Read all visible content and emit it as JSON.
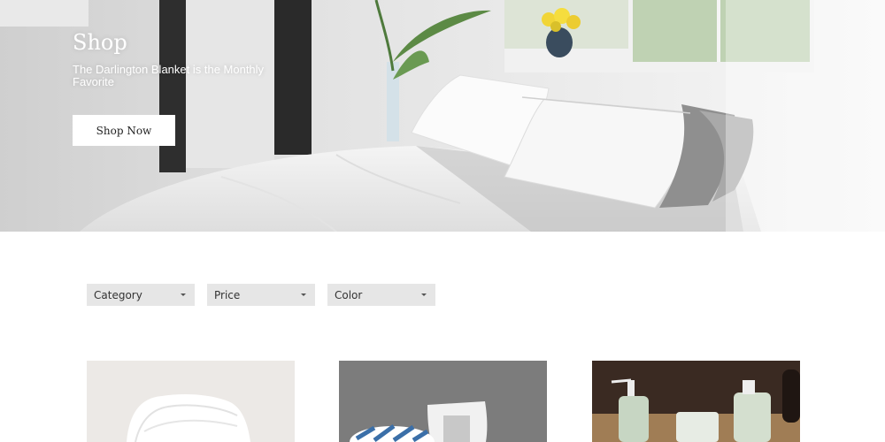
{
  "hero": {
    "title": "Shop",
    "subtitle": "The Darlington Blanket is the Monthly Favorite",
    "cta_label": "Shop Now"
  },
  "filters": [
    {
      "label": "Category"
    },
    {
      "label": "Price"
    },
    {
      "label": "Color"
    }
  ],
  "products": [
    {
      "image": "white-towels-photo"
    },
    {
      "image": "pillows-photo"
    },
    {
      "image": "calm-bath-products-photo"
    }
  ],
  "colors": {
    "hero_text": "#ffffff",
    "filter_bg": "#e6e6e6",
    "button_bg": "#ffffff"
  }
}
